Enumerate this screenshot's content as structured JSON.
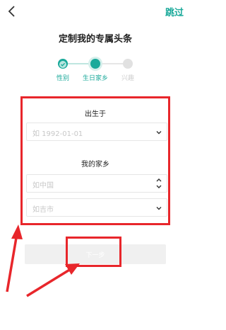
{
  "header": {
    "skip_label": "跳过"
  },
  "title": "定制我的专属头条",
  "steps": [
    {
      "label": "性别",
      "color": "#1aa99a",
      "done": true
    },
    {
      "label": "生日家乡",
      "color": "#1aa99a",
      "done": false
    },
    {
      "label": "兴趣",
      "color": "#d0d0d0",
      "done": false
    }
  ],
  "birth": {
    "label": "出生于",
    "placeholder": "如 1992-01-01"
  },
  "hometown": {
    "label": "我的家乡",
    "country_placeholder": "如中国",
    "city_placeholder": "如吉市"
  },
  "next_label": "下一步",
  "colors": {
    "accent": "#1aa99a",
    "annotation": "#e8262b"
  },
  "icons": [
    "back-arrow-icon",
    "check-icon",
    "chevron-down-icon",
    "chevron-updown-icon"
  ]
}
